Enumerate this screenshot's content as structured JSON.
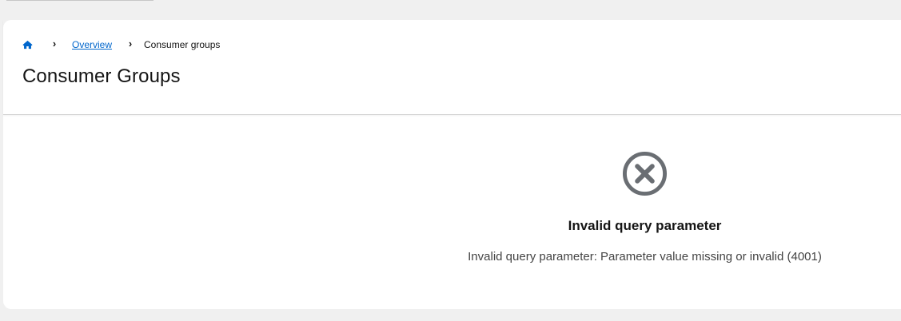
{
  "breadcrumb": {
    "home_icon": "home-icon",
    "separator_icon": "chevron-right-icon",
    "overview": "Overview",
    "current": "Consumer groups"
  },
  "page": {
    "title": "Consumer Groups"
  },
  "empty_state": {
    "icon": "times-circle-icon",
    "title": "Invalid query parameter",
    "body": "Invalid query parameter: Parameter value missing or invalid (4001)"
  },
  "colors": {
    "link": "#0066cc",
    "icon_gray": "#6a6e73",
    "background": "#f0f0f0",
    "card": "#ffffff"
  }
}
